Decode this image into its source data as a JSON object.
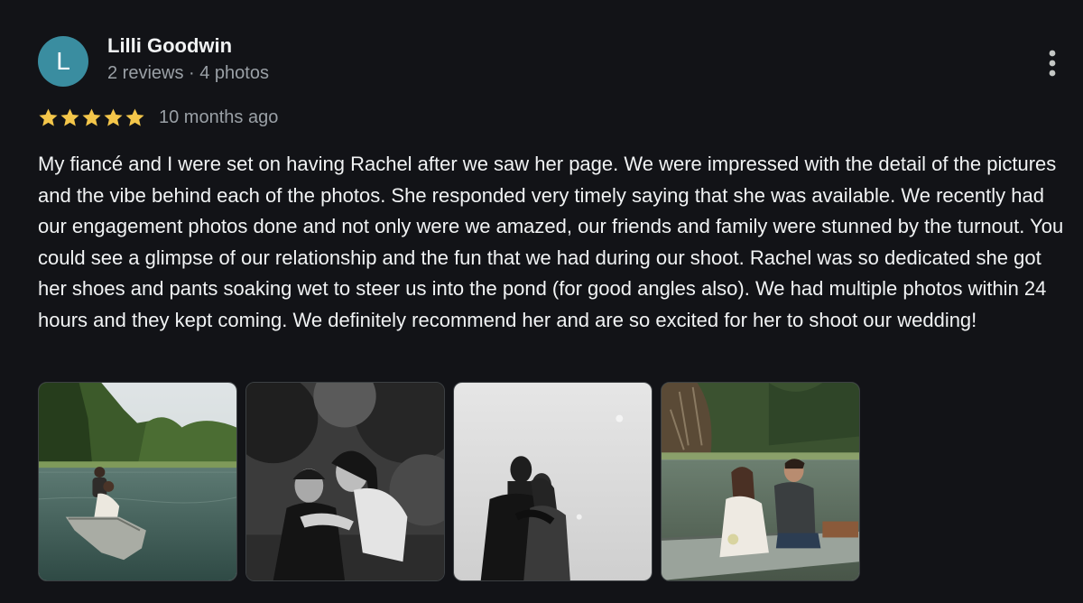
{
  "review": {
    "author": {
      "initial": "L",
      "name": "Lilli Goodwin",
      "meta": "2 reviews · 4 photos",
      "avatar_color": "#3a8da0"
    },
    "rating": 5,
    "rating_max": 5,
    "date": "10 months ago",
    "text": "My fiancé and I were set on having Rachel after we saw her page. We were impressed with the detail of the pictures and the vibe behind each of the photos. She responded very timely saying that she was available. We recently had our engagement photos done and not only were we amazed, our friends and family were stunned by the turnout. You could see a glimpse of our relationship and the fun that we had during our shoot. Rachel was so dedicated she got her shoes and pants soaking wet to steer us into the pond (for good angles also). We had multiple photos within 24 hours and they kept coming. We definitely recommend her and are so excited for her to shoot our wedding!",
    "photos": [
      {
        "subject": "couple in rowboat on pond, color"
      },
      {
        "subject": "piggyback couple laughing, black and white"
      },
      {
        "subject": "couple kissing silhouette against sky, black and white"
      },
      {
        "subject": "couple sitting in boat, color"
      }
    ],
    "icons": {
      "more": "more-vert-icon",
      "star": "star-icon"
    },
    "colors": {
      "background": "#121317",
      "star": "#f4c64a",
      "text": "#f1f3f4",
      "secondary_text": "#9aa0a6"
    }
  }
}
